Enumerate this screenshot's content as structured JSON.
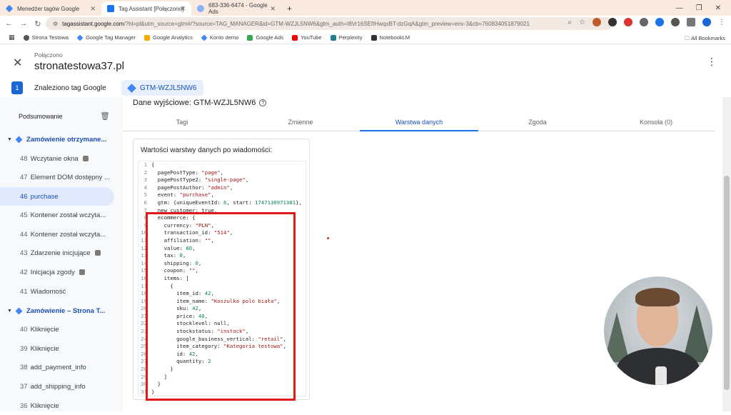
{
  "browser": {
    "tabs": [
      {
        "title": "Menedżer tagów Google",
        "color": "#4285f4"
      },
      {
        "title": "Tag Assistant [Połączono]",
        "color": "#1a73e8"
      },
      {
        "title": "683-336-6474 - Google Ads",
        "color": "#8ab4f8"
      }
    ],
    "new_tab": "+",
    "url_host": "tagassistant.google.com",
    "url_rest": "/?hl=pl&utm_source=gtm#/?source=TAG_MANAGER&id=GTM-WZJL5NW6&gtm_auth=I8Vr16SEfIHwqxBT-dzGqA&gtm_preview=env-3&cb=760834051879021",
    "bookmarks": [
      {
        "label": "Strona Testowa",
        "color": "#555"
      },
      {
        "label": "Google Tag Manager",
        "color": "#4285f4"
      },
      {
        "label": "Google Analytics",
        "color": "#f9ab00"
      },
      {
        "label": "Konto demo",
        "color": "#4285f4"
      },
      {
        "label": "Google Ads",
        "color": "#34a853"
      },
      {
        "label": "YouTube",
        "color": "#ff0000"
      },
      {
        "label": "Perplexity",
        "color": "#20808d"
      },
      {
        "label": "NotebookLM",
        "color": "#333"
      }
    ],
    "all_bookmarks": "All Bookmarks"
  },
  "header": {
    "status": "Połączono",
    "site": "stronatestowa37.pl"
  },
  "tagbar": {
    "badge": "1",
    "found_label": "Znaleziono tag Google",
    "container_id": "GTM-WZJL5NW6"
  },
  "sidebar": {
    "summary": "Podsumowanie",
    "items": [
      {
        "type": "group",
        "label": "Zamówienie otrzymane..."
      },
      {
        "type": "event",
        "num": "48",
        "label": "Wczytanie okna",
        "mini": true
      },
      {
        "type": "event",
        "num": "47",
        "label": "Element DOM dostępny ..."
      },
      {
        "type": "selected",
        "num": "46",
        "label": "purchase"
      },
      {
        "type": "event",
        "num": "45",
        "label": "Kontener został wczyta..."
      },
      {
        "type": "event",
        "num": "44",
        "label": "Kontener został wczyta..."
      },
      {
        "type": "event",
        "num": "43",
        "label": "Zdarzenie inicjujące",
        "mini": true
      },
      {
        "type": "event",
        "num": "42",
        "label": "Inicjacja zgody",
        "mini": true
      },
      {
        "type": "event",
        "num": "41",
        "label": "Wiadomość"
      },
      {
        "type": "group",
        "label": "Zamówienie – Strona T..."
      },
      {
        "type": "event",
        "num": "40",
        "label": "Kliknięcie"
      },
      {
        "type": "event",
        "num": "39",
        "label": "Kliknięcie"
      },
      {
        "type": "event",
        "num": "38",
        "label": "add_payment_info"
      },
      {
        "type": "event",
        "num": "37",
        "label": "add_shipping_info"
      },
      {
        "type": "event",
        "num": "36",
        "label": "Kliknięcie"
      }
    ]
  },
  "main": {
    "output_title": "Dane wyjściowe: GTM-WZJL5NW6",
    "tabs": [
      "Tagi",
      "Zmienne",
      "Warstwa danych",
      "Zgoda",
      "Konsola (0)"
    ],
    "active_tab": 2,
    "panel_title": "Wartości warstwy danych po wiadomości:",
    "code_lines": [
      "{",
      "  pagePostType: \"page\",",
      "  pagePostType2: \"single-page\",",
      "  pagePostAuthor: \"admin\",",
      "  event: \"purchase\",",
      "  gtm: {uniqueEventId: 6, start: 1747130971381},",
      "  new_customer: true,",
      "  ecommerce: {",
      "    currency: \"PLN\",",
      "    transaction_id: \"514\",",
      "    affiliation: \"\",",
      "    value: 80,",
      "    tax: 0,",
      "    shipping: 0,",
      "    coupon: \"\",",
      "    items: [",
      "      {",
      "        item_id: 42,",
      "        item_name: \"Koszulka polo biała\",",
      "        sku: 42,",
      "        price: 40,",
      "        stocklevel: null,",
      "        stockstatus: \"instock\",",
      "        google_business_vertical: \"retail\",",
      "        item_category: \"Kategoria testowa\",",
      "        id: 42,",
      "        quantity: 2",
      "      }",
      "    ]",
      "  }",
      "}"
    ]
  }
}
